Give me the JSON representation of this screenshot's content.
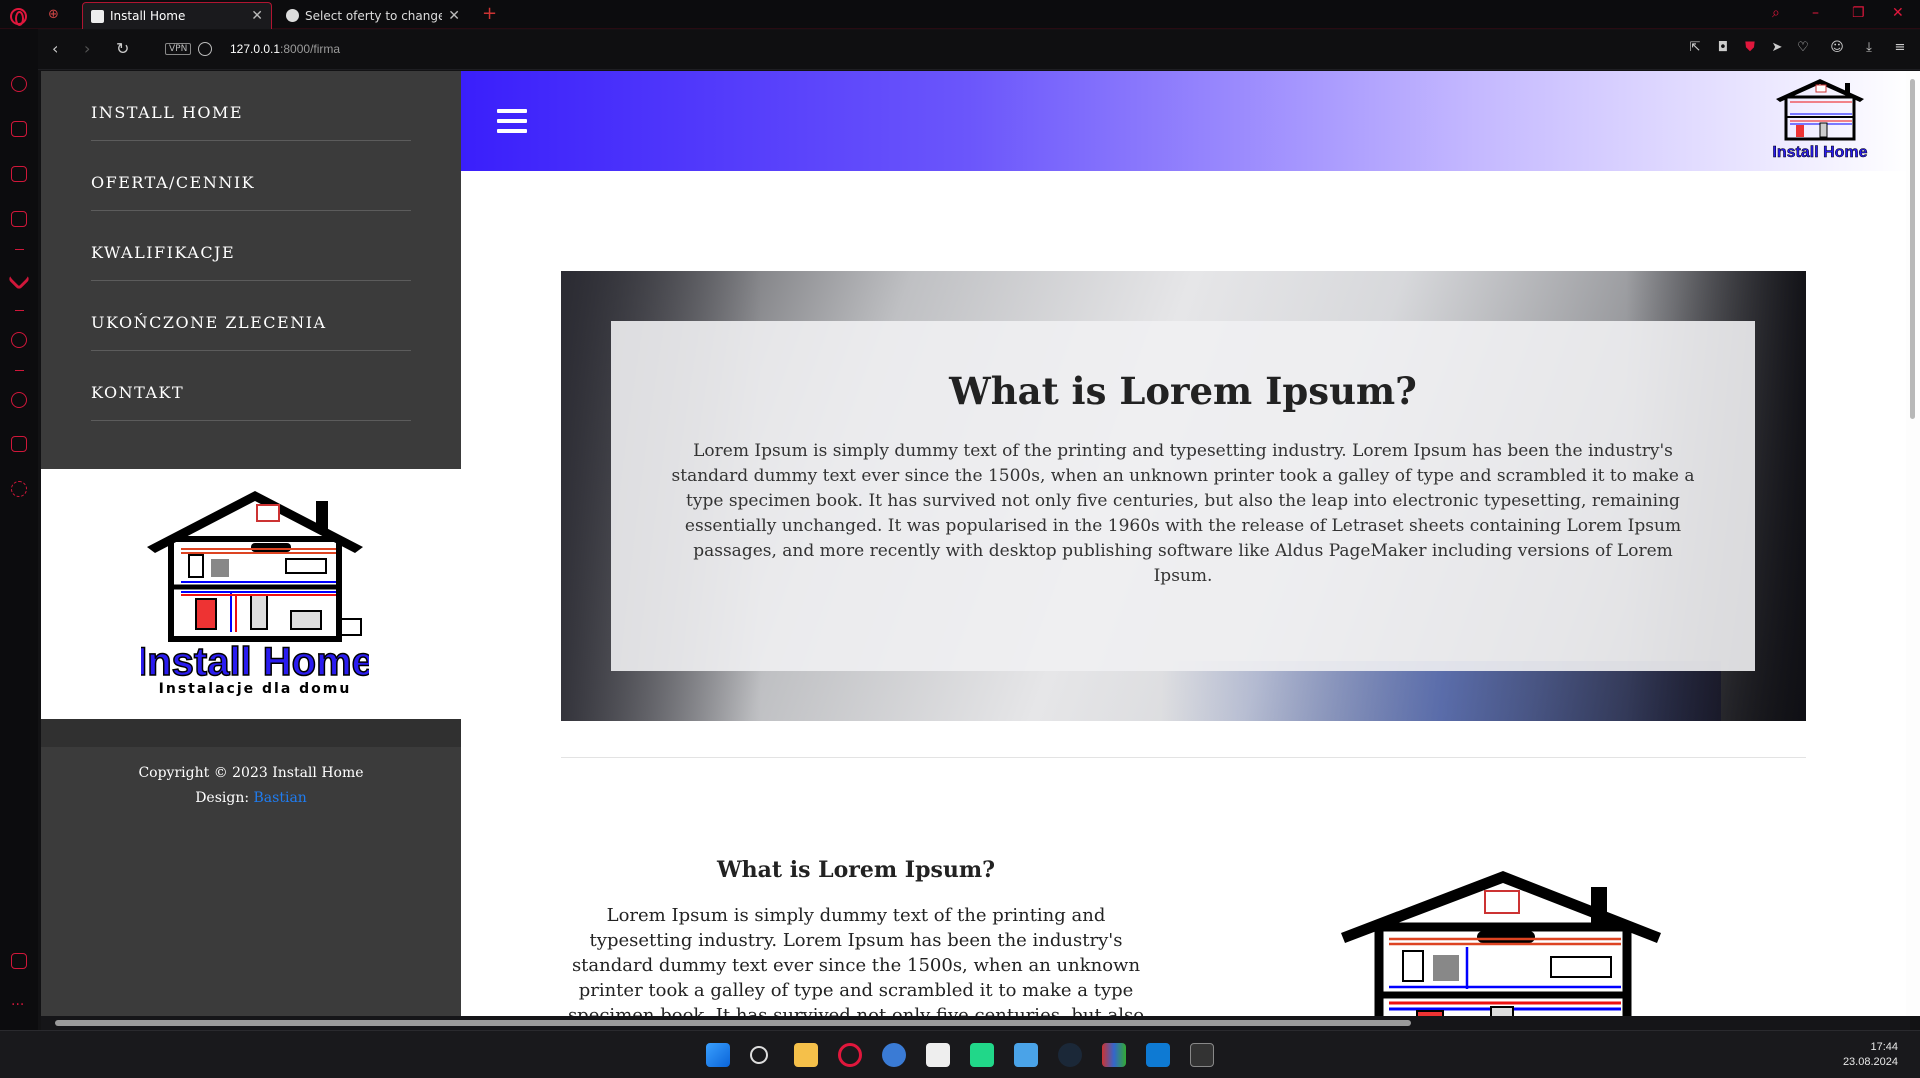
{
  "browser": {
    "tabs": [
      {
        "title": "Install Home",
        "active": true
      },
      {
        "title": "Select oferty to change | Dj",
        "active": false
      }
    ],
    "url_host": "127.0.0.1",
    "url_path": ":8000/firma",
    "vpn_label": "VPN",
    "accent_color": "#e0173c"
  },
  "sidebar": {
    "menu": [
      {
        "label": "INSTALL HOME"
      },
      {
        "label": "OFERTA/CENNIK"
      },
      {
        "label": "KWALIFIKACJE"
      },
      {
        "label": "UKOŃCZONE ZLECENIA"
      },
      {
        "label": "KONTAKT"
      }
    ],
    "logo": {
      "name": "Install Home",
      "tagline": "Instalacje dla domu"
    },
    "footer": {
      "copyright": "Copyright © 2023 Install Home",
      "design_label": "Design:",
      "design_link": "Bastian"
    }
  },
  "banner": {
    "logo_name": "Install Home",
    "gradient_start": "#3a1ffb",
    "gradient_end": "#ffffff"
  },
  "hero": {
    "title": "What is Lorem Ipsum?",
    "text": "Lorem Ipsum is simply dummy text of the printing and typesetting industry. Lorem Ipsum has been the industry's standard dummy text ever since the 1500s, when an unknown printer took a galley of type and scrambled it to make a type specimen book. It has survived not only five centuries, but also the leap into electronic typesetting, remaining essentially unchanged. It was popularised in the 1960s with the release of Letraset sheets containing Lorem Ipsum passages, and more recently with desktop publishing software like Aldus PageMaker including versions of Lorem Ipsum."
  },
  "section": {
    "title": "What is Lorem Ipsum?",
    "text": "Lorem Ipsum is simply dummy text of the printing and typesetting industry. Lorem Ipsum has been the industry's standard dummy text ever since the 1500s, when an unknown printer took a galley of type and scrambled it to make a type specimen book. It has survived not only five centuries, but also the leap into electronic"
  },
  "taskbar": {
    "time": "17:44",
    "date": "23.08.2024"
  }
}
